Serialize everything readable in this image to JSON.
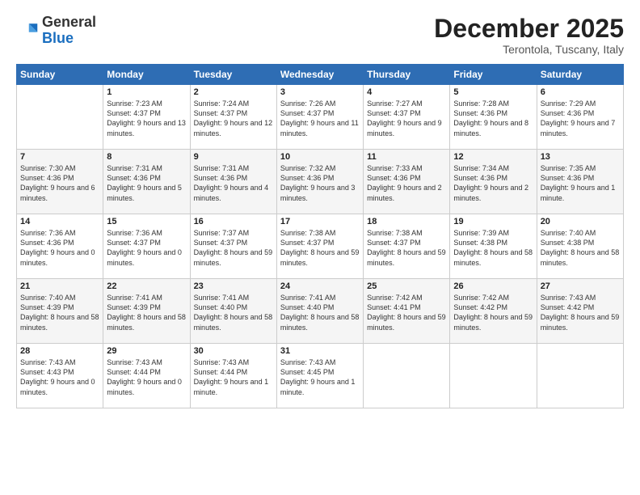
{
  "header": {
    "logo_general": "General",
    "logo_blue": "Blue",
    "month_title": "December 2025",
    "location": "Terontola, Tuscany, Italy"
  },
  "days_of_week": [
    "Sunday",
    "Monday",
    "Tuesday",
    "Wednesday",
    "Thursday",
    "Friday",
    "Saturday"
  ],
  "weeks": [
    [
      {
        "day": "",
        "sunrise": "",
        "sunset": "",
        "daylight": ""
      },
      {
        "day": "1",
        "sunrise": "7:23 AM",
        "sunset": "4:37 PM",
        "daylight": "9 hours and 13 minutes."
      },
      {
        "day": "2",
        "sunrise": "7:24 AM",
        "sunset": "4:37 PM",
        "daylight": "9 hours and 12 minutes."
      },
      {
        "day": "3",
        "sunrise": "7:26 AM",
        "sunset": "4:37 PM",
        "daylight": "9 hours and 11 minutes."
      },
      {
        "day": "4",
        "sunrise": "7:27 AM",
        "sunset": "4:37 PM",
        "daylight": "9 hours and 9 minutes."
      },
      {
        "day": "5",
        "sunrise": "7:28 AM",
        "sunset": "4:36 PM",
        "daylight": "9 hours and 8 minutes."
      },
      {
        "day": "6",
        "sunrise": "7:29 AM",
        "sunset": "4:36 PM",
        "daylight": "9 hours and 7 minutes."
      }
    ],
    [
      {
        "day": "7",
        "sunrise": "7:30 AM",
        "sunset": "4:36 PM",
        "daylight": "9 hours and 6 minutes."
      },
      {
        "day": "8",
        "sunrise": "7:31 AM",
        "sunset": "4:36 PM",
        "daylight": "9 hours and 5 minutes."
      },
      {
        "day": "9",
        "sunrise": "7:31 AM",
        "sunset": "4:36 PM",
        "daylight": "9 hours and 4 minutes."
      },
      {
        "day": "10",
        "sunrise": "7:32 AM",
        "sunset": "4:36 PM",
        "daylight": "9 hours and 3 minutes."
      },
      {
        "day": "11",
        "sunrise": "7:33 AM",
        "sunset": "4:36 PM",
        "daylight": "9 hours and 2 minutes."
      },
      {
        "day": "12",
        "sunrise": "7:34 AM",
        "sunset": "4:36 PM",
        "daylight": "9 hours and 2 minutes."
      },
      {
        "day": "13",
        "sunrise": "7:35 AM",
        "sunset": "4:36 PM",
        "daylight": "9 hours and 1 minute."
      }
    ],
    [
      {
        "day": "14",
        "sunrise": "7:36 AM",
        "sunset": "4:36 PM",
        "daylight": "9 hours and 0 minutes."
      },
      {
        "day": "15",
        "sunrise": "7:36 AM",
        "sunset": "4:37 PM",
        "daylight": "9 hours and 0 minutes."
      },
      {
        "day": "16",
        "sunrise": "7:37 AM",
        "sunset": "4:37 PM",
        "daylight": "8 hours and 59 minutes."
      },
      {
        "day": "17",
        "sunrise": "7:38 AM",
        "sunset": "4:37 PM",
        "daylight": "8 hours and 59 minutes."
      },
      {
        "day": "18",
        "sunrise": "7:38 AM",
        "sunset": "4:37 PM",
        "daylight": "8 hours and 59 minutes."
      },
      {
        "day": "19",
        "sunrise": "7:39 AM",
        "sunset": "4:38 PM",
        "daylight": "8 hours and 58 minutes."
      },
      {
        "day": "20",
        "sunrise": "7:40 AM",
        "sunset": "4:38 PM",
        "daylight": "8 hours and 58 minutes."
      }
    ],
    [
      {
        "day": "21",
        "sunrise": "7:40 AM",
        "sunset": "4:39 PM",
        "daylight": "8 hours and 58 minutes."
      },
      {
        "day": "22",
        "sunrise": "7:41 AM",
        "sunset": "4:39 PM",
        "daylight": "8 hours and 58 minutes."
      },
      {
        "day": "23",
        "sunrise": "7:41 AM",
        "sunset": "4:40 PM",
        "daylight": "8 hours and 58 minutes."
      },
      {
        "day": "24",
        "sunrise": "7:41 AM",
        "sunset": "4:40 PM",
        "daylight": "8 hours and 58 minutes."
      },
      {
        "day": "25",
        "sunrise": "7:42 AM",
        "sunset": "4:41 PM",
        "daylight": "8 hours and 59 minutes."
      },
      {
        "day": "26",
        "sunrise": "7:42 AM",
        "sunset": "4:42 PM",
        "daylight": "8 hours and 59 minutes."
      },
      {
        "day": "27",
        "sunrise": "7:43 AM",
        "sunset": "4:42 PM",
        "daylight": "8 hours and 59 minutes."
      }
    ],
    [
      {
        "day": "28",
        "sunrise": "7:43 AM",
        "sunset": "4:43 PM",
        "daylight": "9 hours and 0 minutes."
      },
      {
        "day": "29",
        "sunrise": "7:43 AM",
        "sunset": "4:44 PM",
        "daylight": "9 hours and 0 minutes."
      },
      {
        "day": "30",
        "sunrise": "7:43 AM",
        "sunset": "4:44 PM",
        "daylight": "9 hours and 1 minute."
      },
      {
        "day": "31",
        "sunrise": "7:43 AM",
        "sunset": "4:45 PM",
        "daylight": "9 hours and 1 minute."
      },
      {
        "day": "",
        "sunrise": "",
        "sunset": "",
        "daylight": ""
      },
      {
        "day": "",
        "sunrise": "",
        "sunset": "",
        "daylight": ""
      },
      {
        "day": "",
        "sunrise": "",
        "sunset": "",
        "daylight": ""
      }
    ]
  ]
}
